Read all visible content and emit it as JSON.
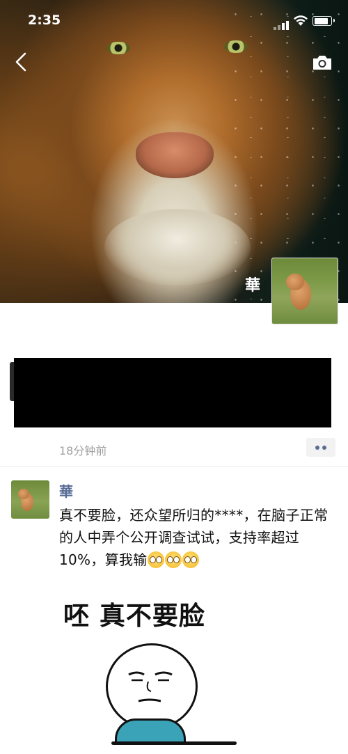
{
  "status_bar": {
    "time": "2:35"
  },
  "profile": {
    "name": "華"
  },
  "post": {
    "time_ago": "18分钟前"
  },
  "comment": {
    "author": "華",
    "text": "真不要脸，还众望所归的****，在脑子正常的人中弄个公开调查试试，支持率超过 10%，算我输",
    "emoji_count": 3,
    "image_caption": "呸 真不要脸"
  },
  "icons": [
    "back-icon",
    "camera-icon",
    "more-icon"
  ],
  "colors": {
    "link_name": "#576b95",
    "time_gray": "#a0a0a0"
  }
}
